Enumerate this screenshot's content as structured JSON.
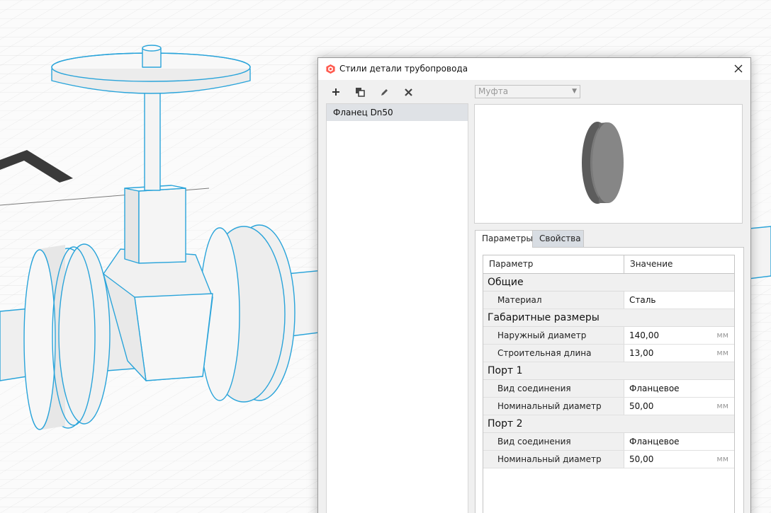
{
  "dialog": {
    "title": "Стили детали трубопровода",
    "list": {
      "items": [
        {
          "label": "Фланец Dn50",
          "selected": true
        }
      ]
    },
    "type_select": {
      "value": "Муфта"
    },
    "tabs": [
      {
        "label": "Параметры",
        "active": true
      },
      {
        "label": "Свойства",
        "active": false
      }
    ],
    "grid": {
      "headers": {
        "param": "Параметр",
        "value": "Значение"
      },
      "groups": [
        {
          "label": "Общие",
          "rows": [
            {
              "name": "Материал",
              "value": "Сталь",
              "unit": ""
            }
          ]
        },
        {
          "label": "Габаритные размеры",
          "rows": [
            {
              "name": "Наружный диаметр",
              "value": "140,00",
              "unit": "мм"
            },
            {
              "name": "Строительная длина",
              "value": "13,00",
              "unit": "мм"
            }
          ]
        },
        {
          "label": "Порт 1",
          "rows": [
            {
              "name": "Вид соединения",
              "value": "Фланцевое",
              "unit": ""
            },
            {
              "name": "Номинальный диаметр",
              "value": "50,00",
              "unit": "мм"
            }
          ]
        },
        {
          "label": "Порт 2",
          "rows": [
            {
              "name": "Вид соединения",
              "value": "Фланцевое",
              "unit": ""
            },
            {
              "name": "Номинальный диаметр",
              "value": "50,00",
              "unit": "мм"
            }
          ]
        }
      ]
    }
  },
  "colors": {
    "accent": "#ff5a4e",
    "model_outline": "#2aa4da",
    "preview_disc": "#777777"
  }
}
